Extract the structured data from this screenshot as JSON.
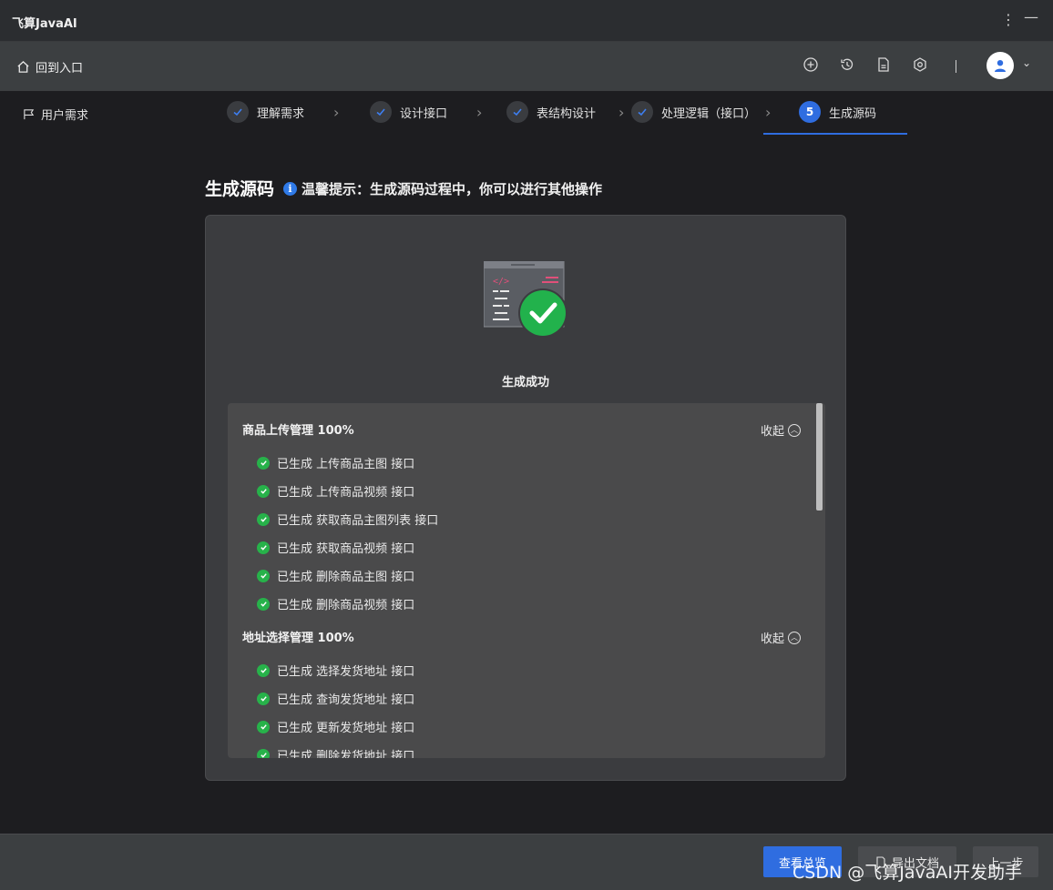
{
  "app": {
    "title": "飞算JavaAI"
  },
  "toolbar": {
    "home_label": "回到入口",
    "separator": "|"
  },
  "nav": {
    "user_requirements": "用户需求"
  },
  "steps": [
    {
      "label": "理解需求",
      "status": "done"
    },
    {
      "label": "设计接口",
      "status": "done"
    },
    {
      "label": "表结构设计",
      "status": "done"
    },
    {
      "label": "处理逻辑（接口）",
      "status": "done"
    },
    {
      "label": "生成源码",
      "number": "5",
      "status": "active"
    }
  ],
  "page": {
    "title": "生成源码",
    "tip": "温馨提示：生成源码过程中，你可以进行其他操作",
    "success_text": "生成成功",
    "collapse_label": "收起"
  },
  "groups": [
    {
      "title": "商品上传管理 100%",
      "items": [
        "已生成 上传商品主图 接口",
        "已生成 上传商品视频 接口",
        "已生成 获取商品主图列表 接口",
        "已生成 获取商品视频 接口",
        "已生成 删除商品主图 接口",
        "已生成 删除商品视频 接口"
      ]
    },
    {
      "title": "地址选择管理 100%",
      "items": [
        "已生成 选择发货地址 接口",
        "已生成 查询发货地址 接口",
        "已生成 更新发货地址 接口",
        "已生成 删除发货地址 接口"
      ]
    }
  ],
  "footer": {
    "view_overview": "查看总览",
    "export_docs": "导出文档",
    "prev_step": "上一步"
  },
  "watermark": "CSDN @飞算JavaAI开发助手",
  "colors": {
    "accent": "#2f6de0",
    "success": "#27b24a",
    "background": "#1d1d20"
  }
}
